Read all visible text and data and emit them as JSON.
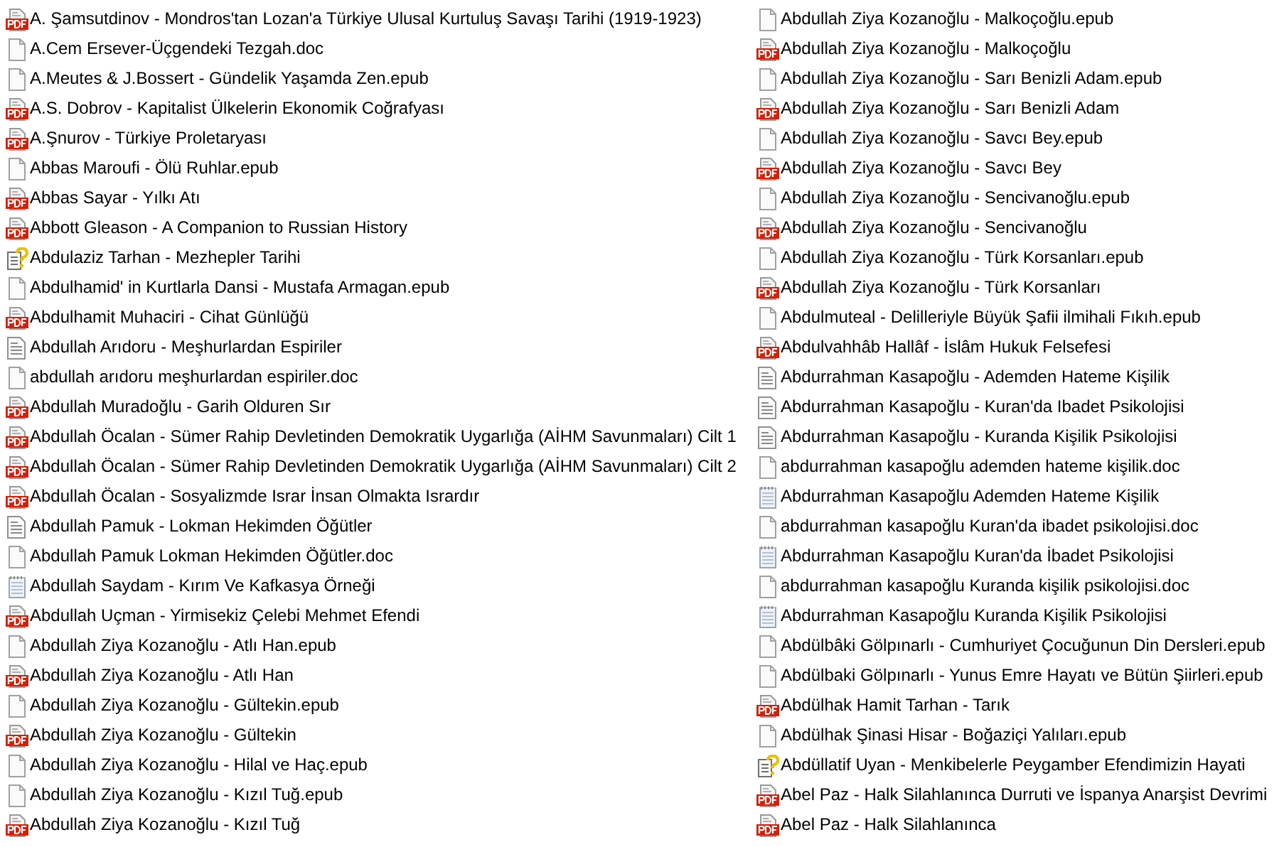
{
  "columns": [
    [
      {
        "kind": "pdf",
        "name": "A. Şamsutdinov - Mondros'tan Lozan'a Türkiye Ulusal Kurtuluş Savaşı Tarihi (1919-1923)"
      },
      {
        "kind": "file",
        "name": "A.Cem Ersever-Üçgendeki Tezgah.doc"
      },
      {
        "kind": "file",
        "name": "A.Meutes & J.Bossert - Gündelik Yaşamda Zen.epub"
      },
      {
        "kind": "pdf",
        "name": "A.S. Dobrov - Kapitalist Ülkelerin Ekonomik Coğrafyası"
      },
      {
        "kind": "pdf",
        "name": "A.Şnurov - Türkiye Proletaryası"
      },
      {
        "kind": "file",
        "name": "Abbas Maroufi - Ölü Ruhlar.epub"
      },
      {
        "kind": "pdf",
        "name": "Abbas Sayar - Yılkı Atı"
      },
      {
        "kind": "pdf",
        "name": "Abbott Gleason - A Companion to Russian History"
      },
      {
        "kind": "unknown",
        "name": "Abdulaziz Tarhan - Mezhepler Tarihi"
      },
      {
        "kind": "file",
        "name": "Abdulhamid' in Kurtlarla Dansi - Mustafa Armagan.epub"
      },
      {
        "kind": "pdf",
        "name": "Abdulhamit Muhaciri - Cihat Günlüğü"
      },
      {
        "kind": "text",
        "name": "Abdullah Arıdoru - Meşhurlardan Espiriler"
      },
      {
        "kind": "file",
        "name": "abdullah arıdoru meşhurlardan espiriler.doc"
      },
      {
        "kind": "pdf",
        "name": "Abdullah Muradoğlu - Garih Olduren Sır"
      },
      {
        "kind": "pdf",
        "name": "Abdullah Öcalan - Sümer Rahip Devletinden Demokratik Uygarlığa (AİHM Savunmaları) Cilt 1"
      },
      {
        "kind": "pdf",
        "name": "Abdullah Öcalan - Sümer Rahip Devletinden Demokratik Uygarlığa (AİHM Savunmaları) Cilt 2"
      },
      {
        "kind": "pdf",
        "name": "Abdullah Öcalan - Sosyalizmde Israr İnsan Olmakta Isrardır"
      },
      {
        "kind": "text",
        "name": "Abdullah Pamuk - Lokman Hekimden Öğütler"
      },
      {
        "kind": "file",
        "name": "Abdullah Pamuk Lokman Hekimden Öğütler.doc"
      },
      {
        "kind": "notepad",
        "name": "Abdullah Saydam - Kırım Ve Kafkasya Örneği"
      },
      {
        "kind": "pdf",
        "name": "Abdullah Uçman - Yirmisekiz Çelebi Mehmet Efendi"
      },
      {
        "kind": "file",
        "name": "Abdullah Ziya Kozanoğlu - Atlı Han.epub"
      },
      {
        "kind": "pdf",
        "name": "Abdullah Ziya Kozanoğlu - Atlı Han"
      },
      {
        "kind": "file",
        "name": "Abdullah Ziya Kozanoğlu - Gültekin.epub"
      },
      {
        "kind": "pdf",
        "name": "Abdullah Ziya Kozanoğlu - Gültekin"
      },
      {
        "kind": "file",
        "name": "Abdullah Ziya Kozanoğlu - Hilal ve Haç.epub"
      },
      {
        "kind": "file",
        "name": "Abdullah Ziya Kozanoğlu - Kızıl Tuğ.epub"
      },
      {
        "kind": "pdf",
        "name": "Abdullah Ziya Kozanoğlu - Kızıl Tuğ"
      }
    ],
    [
      {
        "kind": "file",
        "name": "Abdullah Ziya Kozanoğlu - Malkoçoğlu.epub"
      },
      {
        "kind": "pdf",
        "name": "Abdullah Ziya Kozanoğlu - Malkoçoğlu"
      },
      {
        "kind": "file",
        "name": "Abdullah Ziya Kozanoğlu - Sarı Benizli Adam.epub"
      },
      {
        "kind": "pdf",
        "name": "Abdullah Ziya Kozanoğlu - Sarı Benizli Adam"
      },
      {
        "kind": "file",
        "name": "Abdullah Ziya Kozanoğlu - Savcı Bey.epub"
      },
      {
        "kind": "pdf",
        "name": "Abdullah Ziya Kozanoğlu - Savcı Bey"
      },
      {
        "kind": "file",
        "name": "Abdullah Ziya Kozanoğlu - Sencivanoğlu.epub"
      },
      {
        "kind": "pdf",
        "name": "Abdullah Ziya Kozanoğlu - Sencivanoğlu"
      },
      {
        "kind": "file",
        "name": "Abdullah Ziya Kozanoğlu - Türk Korsanları.epub"
      },
      {
        "kind": "pdf",
        "name": "Abdullah Ziya Kozanoğlu - Türk Korsanları"
      },
      {
        "kind": "file",
        "name": "Abdulmuteal - Delilleriyle Büyük Şafii ilmihali Fıkıh.epub"
      },
      {
        "kind": "pdf",
        "name": "Abdulvahhâb Hallâf - İslâm Hukuk Felsefesi"
      },
      {
        "kind": "text",
        "name": "Abdurrahman Kasapoğlu - Ademden Hateme Kişilik"
      },
      {
        "kind": "text",
        "name": "Abdurrahman Kasapoğlu - Kuran'da Ibadet Psikolojisi"
      },
      {
        "kind": "text",
        "name": "Abdurrahman Kasapoğlu - Kuranda Kişilik Psikolojisi"
      },
      {
        "kind": "file",
        "name": "abdurrahman kasapoğlu ademden hateme kişilik.doc"
      },
      {
        "kind": "notepad",
        "name": "Abdurrahman Kasapoğlu Ademden Hateme Kişilik"
      },
      {
        "kind": "file",
        "name": "abdurrahman kasapoğlu Kuran'da ibadet psikolojisi.doc"
      },
      {
        "kind": "notepad",
        "name": "Abdurrahman Kasapoğlu Kuran'da İbadet Psikolojisi"
      },
      {
        "kind": "file",
        "name": "abdurrahman kasapoğlu Kuranda kişilik psikolojisi.doc"
      },
      {
        "kind": "notepad",
        "name": "Abdurrahman Kasapoğlu Kuranda Kişilik Psikolojisi"
      },
      {
        "kind": "file",
        "name": "Abdülbâki Gölpınarlı - Cumhuriyet Çocuğunun Din Dersleri.epub"
      },
      {
        "kind": "file",
        "name": "Abdülbaki Gölpınarlı - Yunus Emre Hayatı ve Bütün Şiirleri.epub"
      },
      {
        "kind": "pdf",
        "name": "Abdülhak Hamit Tarhan - Tarık"
      },
      {
        "kind": "file",
        "name": "Abdülhak Şinasi Hisar - Boğaziçi Yalıları.epub"
      },
      {
        "kind": "unknown",
        "name": "Abdüllatif Uyan - Menkibelerle Peygamber Efendimizin Hayati"
      },
      {
        "kind": "pdf",
        "name": "Abel Paz - Halk Silahlanınca Durruti ve İspanya Anarşist Devrimi"
      },
      {
        "kind": "pdf",
        "name": "Abel Paz - Halk Silahlanınca"
      }
    ]
  ]
}
